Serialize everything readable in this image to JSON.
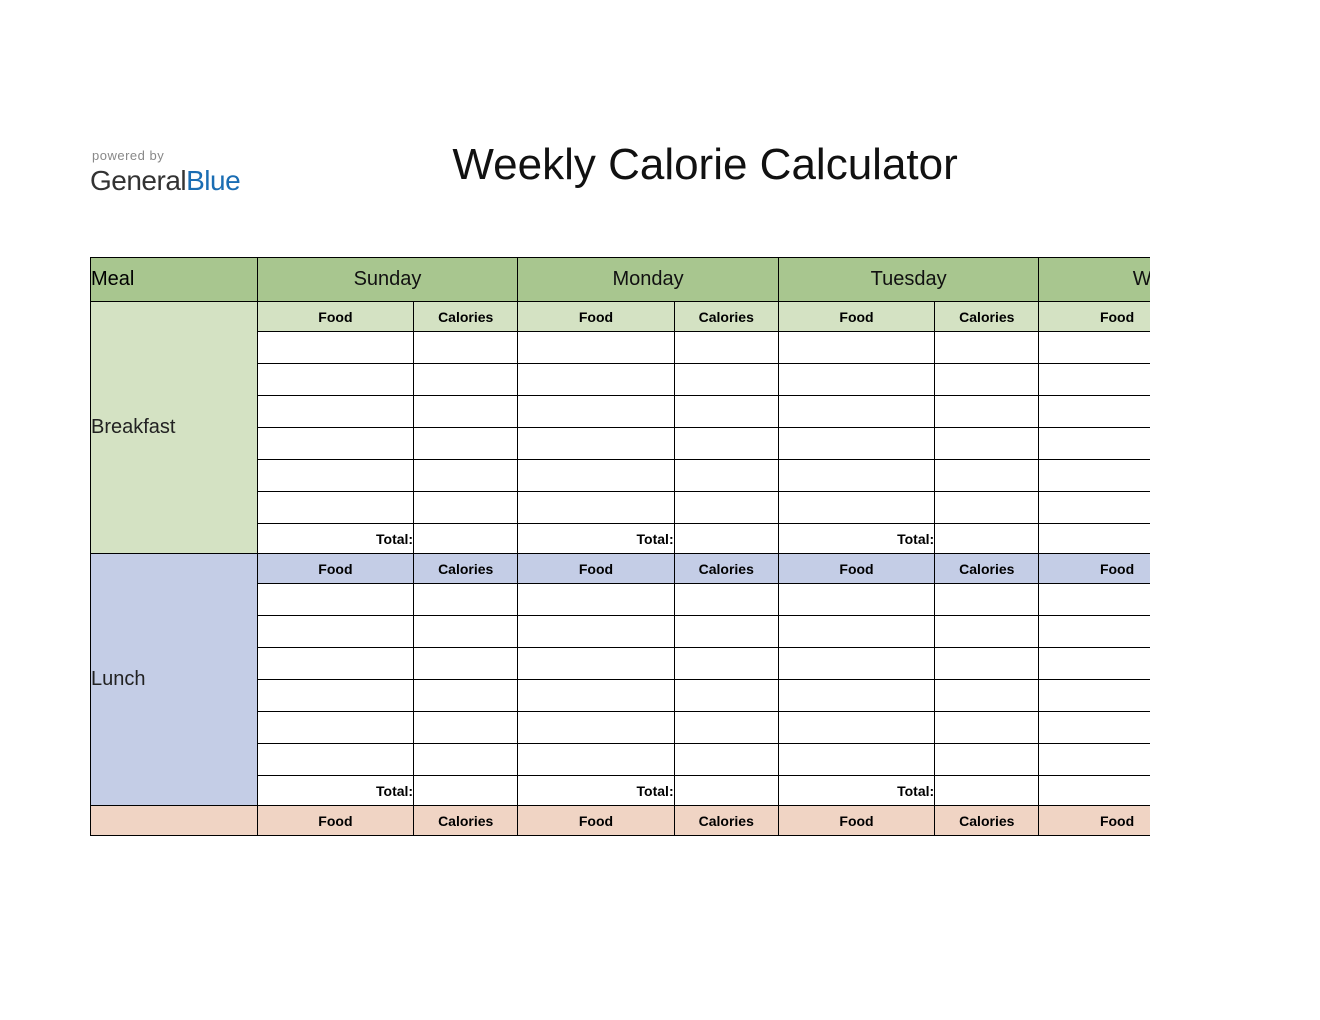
{
  "branding": {
    "powered_by": "powered by",
    "logo_part1": "General",
    "logo_part2": "Blue"
  },
  "title": "Weekly Calorie Calculator",
  "headers": {
    "meal": "Meal",
    "days": [
      "Sunday",
      "Monday",
      "Tuesday",
      "Wednes"
    ],
    "food": "Food",
    "calories": "Calories",
    "total": "Total:"
  },
  "meals": [
    {
      "id": "breakfast",
      "label": "Breakfast",
      "bg": "bg-breakfast"
    },
    {
      "id": "lunch",
      "label": "Lunch",
      "bg": "bg-lunch"
    },
    {
      "id": "dinner",
      "label": "",
      "bg": "bg-dinner"
    }
  ],
  "rows_per_meal": 6,
  "colors": {
    "day_header": "#a8c68f",
    "breakfast": "#d4e2c3",
    "lunch": "#c4cde6",
    "dinner": "#f0d4c4"
  }
}
